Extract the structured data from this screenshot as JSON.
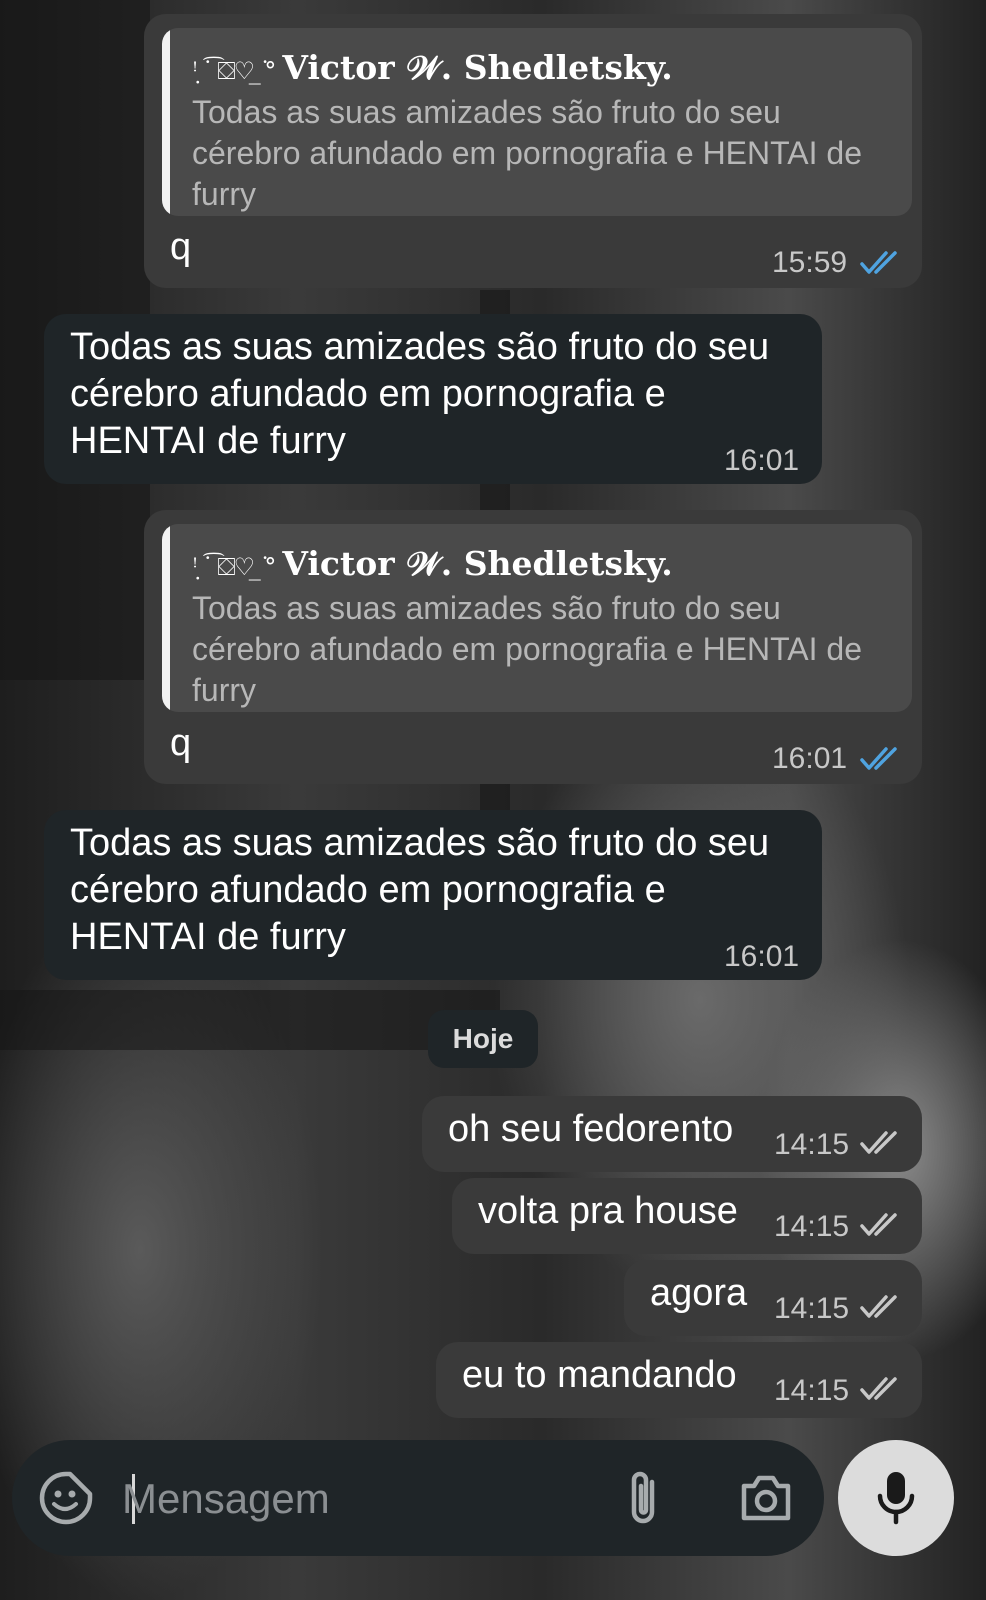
{
  "messages": [
    {
      "type": "outgoing_reply",
      "reply": {
        "sender_decoration": "ꜝ ̣˙͡ ⛋♡ ̲ ͘°",
        "sender_name": "Victor 𝒲. Shedletsky.",
        "text": "Todas as suas amizades são fruto do seu cérebro afundado em pornografia e HENTAI de furry"
      },
      "text": "q",
      "time": "15:59",
      "status": "read"
    },
    {
      "type": "incoming",
      "text": "Todas as suas amizades são fruto do seu cérebro afundado em pornografia e HENTAI de furry",
      "time": "16:01"
    },
    {
      "type": "outgoing_reply",
      "reply": {
        "sender_decoration": "ꜝ ̣˙͡ ⛋♡ ̲ ͘°",
        "sender_name": "Victor 𝒲. Shedletsky.",
        "text": "Todas as suas amizades são fruto do seu cérebro afundado em pornografia e HENTAI de furry"
      },
      "text": "q",
      "time": "16:01",
      "status": "read"
    },
    {
      "type": "incoming",
      "text": "Todas as suas amizades são fruto do seu cérebro afundado em pornografia e HENTAI de furry",
      "time": "16:01"
    }
  ],
  "date_separator": "Hoje",
  "recent_messages": [
    {
      "text": "oh seu fedorento",
      "time": "14:15",
      "status": "delivered"
    },
    {
      "text": "volta pra house",
      "time": "14:15",
      "status": "delivered"
    },
    {
      "text": "agora",
      "time": "14:15",
      "status": "delivered"
    },
    {
      "text": "eu to mandando",
      "time": "14:15",
      "status": "delivered"
    }
  ],
  "composer": {
    "placeholder": "Mensagem",
    "icons": [
      "sticker-icon",
      "attach-icon",
      "camera-icon",
      "mic-icon"
    ]
  },
  "colors": {
    "read_check": "#4fa3e0",
    "delivered_check": "#c8c8c8",
    "outgoing_bubble": "#3a3a3a",
    "incoming_bubble": "#1f2528"
  }
}
